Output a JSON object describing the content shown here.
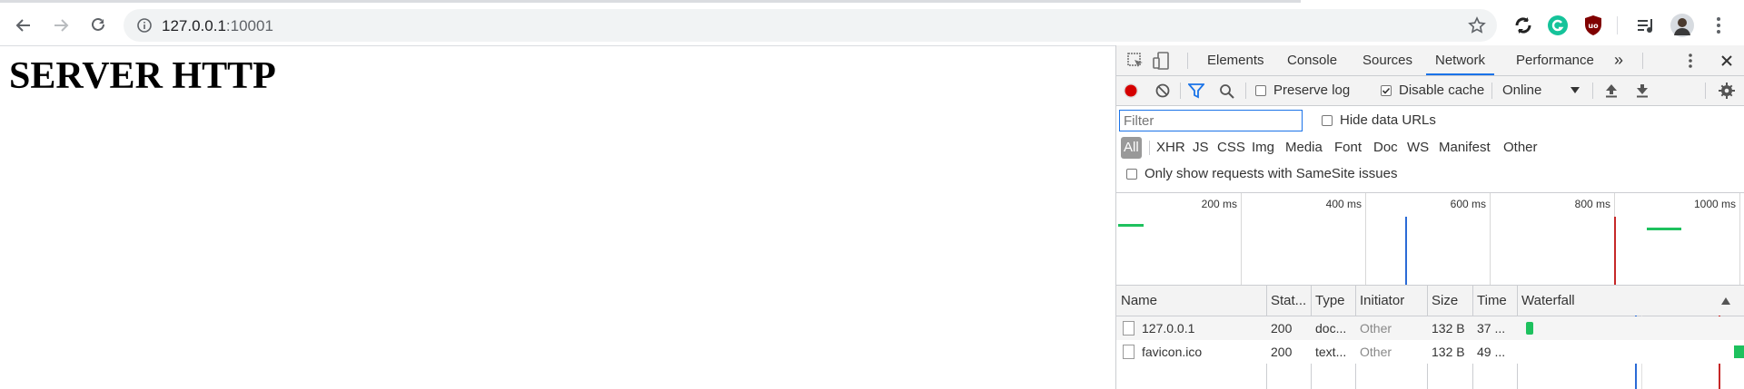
{
  "browser": {
    "url_host": "127.0.0.1",
    "url_port": ":10001",
    "icons": [
      "back-icon",
      "forward-icon",
      "reload-icon",
      "site-info-icon",
      "bookmark-star-icon",
      "sync-extension-icon",
      "grammarly-extension-icon",
      "ublock-extension-icon",
      "media-queue-icon",
      "profile-avatar",
      "chrome-menu-icon"
    ]
  },
  "page": {
    "heading": "SERVER HTTP"
  },
  "devtools": {
    "tabs": [
      {
        "label": "Elements"
      },
      {
        "label": "Console"
      },
      {
        "label": "Sources"
      },
      {
        "label": "Network",
        "active": true
      },
      {
        "label": "Performance"
      }
    ],
    "more_tabs": "»",
    "toolbar": {
      "preserve_log": "Preserve log",
      "preserve_log_checked": false,
      "disable_cache": "Disable cache",
      "disable_cache_checked": true,
      "throttling": "Online"
    },
    "filter": {
      "placeholder": "Filter",
      "hide_data_urls": "Hide data URLs",
      "types": [
        "All",
        "XHR",
        "JS",
        "CSS",
        "Img",
        "Media",
        "Font",
        "Doc",
        "WS",
        "Manifest",
        "Other"
      ],
      "active_type": "All",
      "samesite": "Only show requests with SameSite issues"
    },
    "overview": {
      "ticks": [
        "200 ms",
        "400 ms",
        "600 ms",
        "800 ms",
        "1000 ms"
      ],
      "colors": {
        "request": "#1ec15e",
        "dom_content_loaded": "#2b6bd6",
        "load": "#c62828"
      }
    },
    "grid": {
      "columns": [
        "Name",
        "Stat...",
        "Type",
        "Initiator",
        "Size",
        "Time",
        "Waterfall"
      ],
      "rows": [
        {
          "name": "127.0.0.1",
          "status": "200",
          "type": "doc...",
          "initiator": "Other",
          "size": "132 B",
          "time": "37 ..."
        },
        {
          "name": "favicon.ico",
          "status": "200",
          "type": "text...",
          "initiator": "Other",
          "size": "132 B",
          "time": "49 ..."
        }
      ]
    }
  }
}
